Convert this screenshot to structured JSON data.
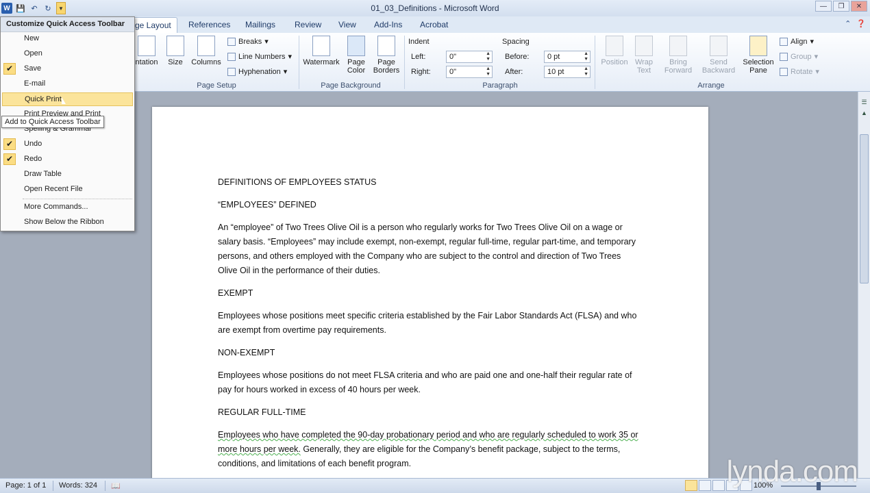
{
  "window": {
    "title": "01_03_Definitions - Microsoft Word",
    "controls": [
      "minimize-icon",
      "restore-icon",
      "close-icon"
    ]
  },
  "qat": {
    "icons": [
      "word-logo-icon",
      "save-icon",
      "undo-icon",
      "redo-icon",
      "customize-dropdown-icon"
    ]
  },
  "tabs": [
    "ge Layout",
    "References",
    "Mailings",
    "Review",
    "View",
    "Add-Ins",
    "Acrobat"
  ],
  "ribbon": {
    "page_setup": {
      "orientation": "ntation",
      "size": "Size",
      "columns": "Columns",
      "breaks": "Breaks",
      "line_numbers": "Line Numbers",
      "hyphenation": "Hyphenation",
      "label": "Page Setup"
    },
    "page_background": {
      "watermark": "Watermark",
      "page_color_1": "Page",
      "page_color_2": "Color",
      "page_borders_1": "Page",
      "page_borders_2": "Borders",
      "label": "Page Background"
    },
    "paragraph": {
      "indent": "Indent",
      "left_label": "Left:",
      "left_value": "0\"",
      "right_label": "Right:",
      "right_value": "0\"",
      "spacing": "Spacing",
      "before_label": "Before:",
      "before_value": "0 pt",
      "after_label": "After:",
      "after_value": "10 pt",
      "label": "Paragraph"
    },
    "arrange": {
      "position": "Position",
      "wrap_text_1": "Wrap",
      "wrap_text_2": "Text",
      "bring_forward_1": "Bring",
      "bring_forward_2": "Forward",
      "send_backward_1": "Send",
      "send_backward_2": "Backward",
      "selection_pane_1": "Selection",
      "selection_pane_2": "Pane",
      "align": "Align",
      "group": "Group",
      "rotate": "Rotate",
      "label": "Arrange"
    }
  },
  "menu": {
    "header": "Customize Quick Access Toolbar",
    "items": [
      "New",
      "Open",
      "Save",
      "E-mail",
      "Quick Print",
      "Print Preview and Print",
      "Spelling & Grammar",
      "Undo",
      "Redo",
      "Draw Table",
      "Open Recent File",
      "More Commands...",
      "Show Below the Ribbon"
    ],
    "checked": [
      "Save",
      "Undo",
      "Redo"
    ],
    "highlighted": "Quick Print",
    "tooltip": "Add to Quick Access Toolbar"
  },
  "document": {
    "title": "DEFINITIONS OF EMPLOYEES STATUS",
    "h1": " “EMPLOYEES” DEFINED",
    "p1": "An “employee” of Two Trees Olive Oil is a  person who regularly works for Two Trees Olive Oil on a wage or salary basis.  “Employees” may include exempt, non-exempt, regular full-time, regular part-time, and temporary persons, and others employed with the Company who are subject to the control and direction of Two Trees Olive Oil in the performance of their duties.",
    "h2": "EXEMPT",
    "p2": "Employees whose positions meet specific criteria established by the Fair Labor Standards Act (FLSA) and who are exempt from overtime pay requirements.",
    "h3": "NON-EXEMPT",
    "p3": "Employees whose positions do not meet FLSA criteria and who are paid one and one-half their regular rate of pay for hours worked in excess of 40 hours per week.",
    "h4": "REGULAR FULL-TIME",
    "p4a": "Employees who have completed the 90-day probationary period and who are regularly scheduled to work 35  or more hours per week.",
    "p4b": "  Generally, they are eligible for the Company’s benefit package, subject to the terms, conditions, and limitations of each benefit program."
  },
  "status": {
    "page": "Page: 1 of 1",
    "words": "Words: 324",
    "zoom": "100%"
  },
  "watermark": "lynda.com",
  "colors": {
    "ribbon_bg": "#e6edf7",
    "highlight": "#fbe49b",
    "doc_bg": "#a4adbb"
  }
}
